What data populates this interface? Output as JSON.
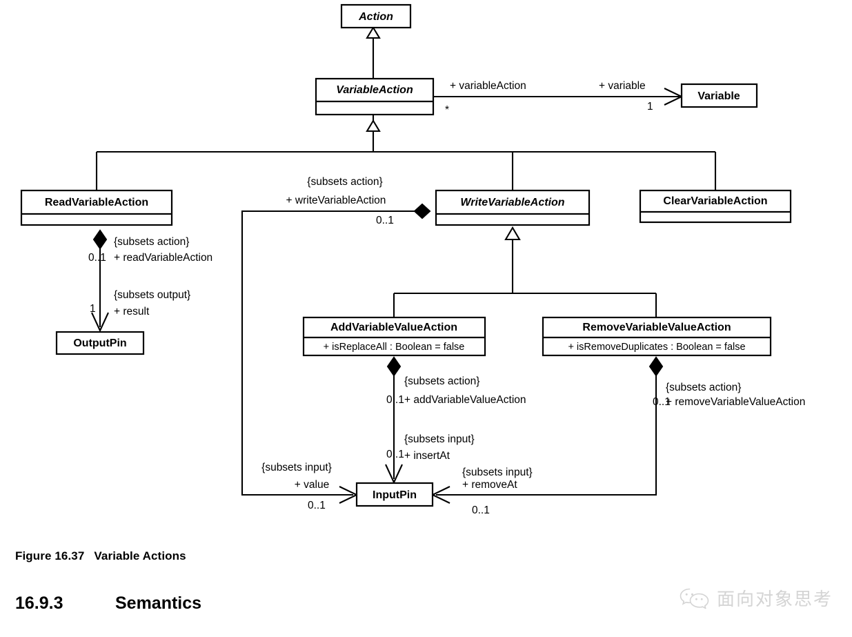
{
  "figure": {
    "number": "Figure 16.37",
    "title": "Variable Actions"
  },
  "section": {
    "number": "16.9.3",
    "title": "Semantics"
  },
  "watermark": {
    "text": "面向对象思考",
    "icon": "wechat-icon"
  },
  "classes": {
    "action": {
      "name": "Action",
      "abstract": true,
      "attribute": ""
    },
    "variable_action": {
      "name": "VariableAction",
      "abstract": true,
      "attribute": ""
    },
    "variable": {
      "name": "Variable",
      "abstract": false,
      "attribute": ""
    },
    "read_variable": {
      "name": "ReadVariableAction",
      "abstract": false,
      "attribute": ""
    },
    "write_variable": {
      "name": "WriteVariableAction",
      "abstract": true,
      "attribute": ""
    },
    "clear_variable": {
      "name": "ClearVariableAction",
      "abstract": false,
      "attribute": ""
    },
    "add_variable": {
      "name": "AddVariableValueAction",
      "abstract": false,
      "attribute": "+ isReplaceAll : Boolean = false"
    },
    "remove_variable": {
      "name": "RemoveVariableValueAction",
      "abstract": false,
      "attribute": "+ isRemoveDuplicates : Boolean = false"
    },
    "output_pin": {
      "name": "OutputPin",
      "abstract": false,
      "attribute": ""
    },
    "input_pin": {
      "name": "InputPin",
      "abstract": false,
      "attribute": ""
    }
  },
  "associations": {
    "variable_action_to_variable": {
      "source_role": "+ variableAction",
      "source_mult": "*",
      "target_role": "+ variable",
      "target_mult": "1"
    },
    "read_to_output": {
      "source_constraint": "{subsets action}",
      "source_role": "+ readVariableAction",
      "source_mult": "0..1",
      "target_constraint": "{subsets output}",
      "target_role": "+ result",
      "target_mult": "1"
    },
    "write_to_input_value": {
      "source_constraint": "{subsets action}",
      "source_role": "+ writeVariableAction",
      "source_mult": "0..1",
      "target_constraint": "{subsets input}",
      "target_role": "+ value",
      "target_mult": "0..1"
    },
    "add_to_input_insertat": {
      "source_constraint": "{subsets action}",
      "source_role": "+ addVariableValueAction",
      "source_mult": "0..1",
      "target_constraint": "{subsets input}",
      "target_role": "+ insertAt",
      "target_mult": "0..1"
    },
    "remove_to_input_removeat": {
      "source_constraint": "{subsets action}",
      "source_role": "+ removeVariableValueAction",
      "source_mult": "0..1",
      "target_constraint": "{subsets input}",
      "target_role": "+ removeAt",
      "target_mult": "0..1"
    }
  },
  "generalizations": [
    {
      "child": "VariableAction",
      "parent": "Action"
    },
    {
      "child": "ReadVariableAction",
      "parent": "VariableAction"
    },
    {
      "child": "WriteVariableAction",
      "parent": "VariableAction"
    },
    {
      "child": "ClearVariableAction",
      "parent": "VariableAction"
    },
    {
      "child": "AddVariableValueAction",
      "parent": "WriteVariableAction"
    },
    {
      "child": "RemoveVariableValueAction",
      "parent": "WriteVariableAction"
    }
  ],
  "colors": {
    "stroke": "#000000",
    "fill": "#ffffff",
    "watermark": "#9a9a9a"
  }
}
